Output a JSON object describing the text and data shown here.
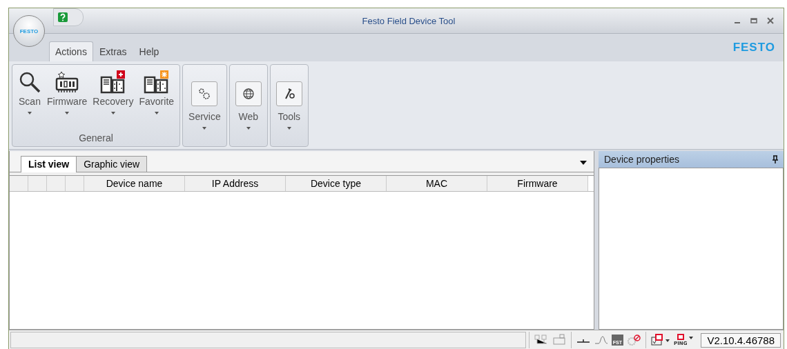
{
  "window": {
    "title": "Festo Field Device Tool",
    "logo": "FESTO"
  },
  "menu_tabs": [
    {
      "label": "Actions",
      "selected": true
    },
    {
      "label": "Extras",
      "selected": false
    },
    {
      "label": "Help",
      "selected": false
    }
  ],
  "brand": "FESTO",
  "ribbon": {
    "groups": [
      {
        "label": "General",
        "buttons": [
          {
            "label": "Scan",
            "kind": "search"
          },
          {
            "label": "Firmware",
            "kind": "chip"
          },
          {
            "label": "Recovery",
            "kind": "recovery"
          },
          {
            "label": "Favorite",
            "kind": "favorite"
          }
        ]
      },
      {
        "buttons": [
          {
            "label": "Service",
            "kind": "gears"
          }
        ]
      },
      {
        "buttons": [
          {
            "label": "Web",
            "kind": "globe"
          }
        ]
      },
      {
        "buttons": [
          {
            "label": "Tools",
            "kind": "tools"
          }
        ]
      }
    ]
  },
  "view_tabs": [
    {
      "label": "List view",
      "selected": true
    },
    {
      "label": "Graphic view",
      "selected": false
    }
  ],
  "table": {
    "columns": [
      "Device name",
      "IP Address",
      "Device type",
      "MAC",
      "Firmware"
    ]
  },
  "properties_panel": {
    "title": "Device properties"
  },
  "status_bar": {
    "icons": [
      {
        "kind": "network"
      },
      {
        "kind": "device"
      },
      {
        "kind": "line"
      },
      {
        "kind": "curve"
      },
      {
        "kind": "fst",
        "label": "FST"
      },
      {
        "kind": "blocked"
      },
      {
        "kind": "check"
      },
      {
        "kind": "ping",
        "label": "PING"
      }
    ],
    "version": "V2.10.4.46788"
  }
}
